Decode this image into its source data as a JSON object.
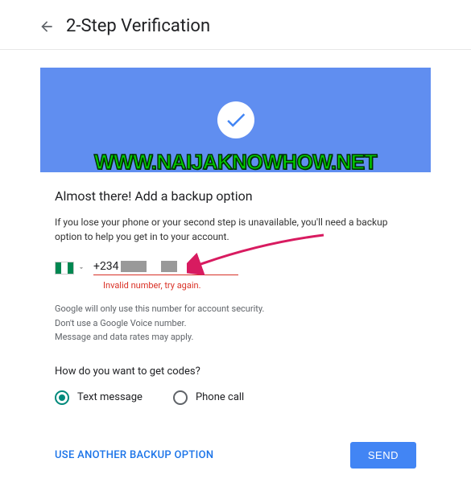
{
  "header": {
    "title": "2-Step Verification"
  },
  "section": {
    "title": "Almost there! Add a backup option",
    "description": "If you lose your phone or your second step is unavailable, you'll need a backup option to help you get in to your account."
  },
  "phone": {
    "prefix": "+234",
    "error": "Invalid number, try again."
  },
  "helper": {
    "line1": "Google will only use this number for account security.",
    "line2": "Don't use a Google Voice number.",
    "line3": "Message and data rates may apply."
  },
  "codes": {
    "question": "How do you want to get codes?",
    "option1": "Text message",
    "option2": "Phone call"
  },
  "actions": {
    "alt": "USE ANOTHER BACKUP OPTION",
    "send": "SEND"
  },
  "watermark": "WWW.NAIJAKNOWHOW.NET"
}
